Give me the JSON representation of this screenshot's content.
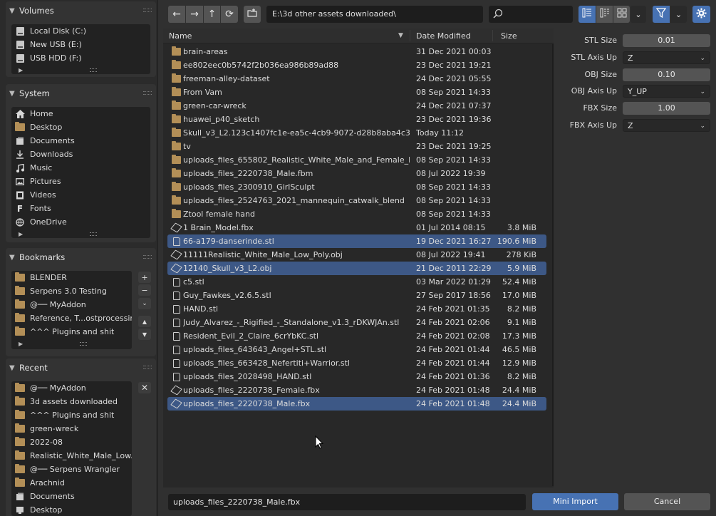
{
  "volumes": {
    "title": "Volumes",
    "items": [
      {
        "label": "Local Disk (C:)"
      },
      {
        "label": "New USB (E:)"
      },
      {
        "label": "USB HDD (F:)"
      }
    ]
  },
  "system": {
    "title": "System",
    "items": [
      {
        "label": "Home",
        "icon": "home-icon"
      },
      {
        "label": "Desktop",
        "icon": "desktop-icon"
      },
      {
        "label": "Documents",
        "icon": "documents-icon"
      },
      {
        "label": "Downloads",
        "icon": "download-icon"
      },
      {
        "label": "Music",
        "icon": "music-icon"
      },
      {
        "label": "Pictures",
        "icon": "pictures-icon"
      },
      {
        "label": "Videos",
        "icon": "videos-icon"
      },
      {
        "label": "Fonts",
        "icon": "font-icon"
      },
      {
        "label": "OneDrive",
        "icon": "onedrive-icon"
      }
    ]
  },
  "bookmarks": {
    "title": "Bookmarks",
    "items": [
      {
        "label": "BLENDER"
      },
      {
        "label": "Serpens 3.0 Testing"
      },
      {
        "label": "@── MyAddon"
      },
      {
        "label": "Reference, T...ostprocessing"
      },
      {
        "label": "^^^ Plugins and shit"
      }
    ]
  },
  "recent": {
    "title": "Recent",
    "items": [
      {
        "label": "@── MyAddon"
      },
      {
        "label": "3d assets downloaded"
      },
      {
        "label": "^^^ Plugins and shit"
      },
      {
        "label": "green-wreck"
      },
      {
        "label": "2022-08"
      },
      {
        "label": "Realistic_White_Male_Low..."
      },
      {
        "label": "@── Serpens Wrangler"
      },
      {
        "label": "Arachnid"
      },
      {
        "label": "Documents"
      },
      {
        "label": "Desktop"
      }
    ]
  },
  "toolbar": {
    "path": "E:\\3d other assets downloaded\\",
    "search_placeholder": ""
  },
  "columns": {
    "name": "Name",
    "date": "Date Modified",
    "size": "Size"
  },
  "files": [
    {
      "type": "folder",
      "name": "brain-areas",
      "date": "31 Dec 2021 00:03",
      "size": "",
      "selected": false
    },
    {
      "type": "folder",
      "name": "ee802eec0b5742f2b036ea986b89ad88",
      "date": "23 Dec 2021 19:21",
      "size": "",
      "selected": false
    },
    {
      "type": "folder",
      "name": "freeman-alley-dataset",
      "date": "24 Dec 2021 05:55",
      "size": "",
      "selected": false
    },
    {
      "type": "folder",
      "name": "From Vam",
      "date": "08 Sep 2021 14:33",
      "size": "",
      "selected": false
    },
    {
      "type": "folder",
      "name": "green-car-wreck",
      "date": "24 Dec 2021 07:37",
      "size": "",
      "selected": false
    },
    {
      "type": "folder",
      "name": "huawei_p40_sketch",
      "date": "23 Dec 2021 19:36",
      "size": "",
      "selected": false
    },
    {
      "type": "folder",
      "name": "Skull_v3_L2.123c1407fc1e-ea5c-4cb9-9072-d28b8aba4c36",
      "date": "Today 11:12",
      "size": "",
      "selected": false
    },
    {
      "type": "folder",
      "name": "tv",
      "date": "23 Dec 2021 19:25",
      "size": "",
      "selected": false
    },
    {
      "type": "folder",
      "name": "uploads_files_655802_Realistic_White_Male_and_Female_Low_Po",
      "date": "08 Sep 2021 14:33",
      "size": "",
      "selected": false
    },
    {
      "type": "folder",
      "name": "uploads_files_2220738_Male.fbm",
      "date": "08 Jul 2022 19:39",
      "size": "",
      "selected": false
    },
    {
      "type": "folder",
      "name": "uploads_files_2300910_GirlSculpt",
      "date": "08 Sep 2021 14:33",
      "size": "",
      "selected": false
    },
    {
      "type": "folder",
      "name": "uploads_files_2524763_2021_mannequin_catwalk_blend",
      "date": "08 Sep 2021 14:33",
      "size": "",
      "selected": false
    },
    {
      "type": "folder",
      "name": "Ztool female hand",
      "date": "08 Sep 2021 14:33",
      "size": "",
      "selected": false
    },
    {
      "type": "mesh",
      "name": "1 Brain_Model.fbx",
      "date": "01 Jul 2014 08:15",
      "size": "3.8 MiB",
      "selected": false
    },
    {
      "type": "file",
      "name": "66-a179-danserinde.stl",
      "date": "19 Dec 2021 16:27",
      "size": "190.6 MiB",
      "selected": true
    },
    {
      "type": "mesh",
      "name": "11111Realistic_White_Male_Low_Poly.obj",
      "date": "08 Jul 2022 19:41",
      "size": "278 KiB",
      "selected": false
    },
    {
      "type": "mesh",
      "name": "12140_Skull_v3_L2.obj",
      "date": "21 Dec 2011 22:29",
      "size": "5.9 MiB",
      "selected": true
    },
    {
      "type": "file",
      "name": "c5.stl",
      "date": "03 Mar 2022 01:29",
      "size": "52.4 MiB",
      "selected": false
    },
    {
      "type": "file",
      "name": "Guy_Fawkes_v2.6.5.stl",
      "date": "27 Sep 2017 18:56",
      "size": "17.0 MiB",
      "selected": false
    },
    {
      "type": "file",
      "name": "HAND.stl",
      "date": "24 Feb 2021 01:35",
      "size": "8.2 MiB",
      "selected": false
    },
    {
      "type": "file",
      "name": "Judy_Alvarez_-_Rigified_-_Standalone_v1.3_rDKWJAn.stl",
      "date": "24 Feb 2021 02:06",
      "size": "9.1 MiB",
      "selected": false
    },
    {
      "type": "file",
      "name": "Resident_Evil_2_Claire_6crYbKC.stl",
      "date": "24 Feb 2021 02:08",
      "size": "17.3 MiB",
      "selected": false
    },
    {
      "type": "file",
      "name": "uploads_files_643643_Angel+STL.stl",
      "date": "24 Feb 2021 01:44",
      "size": "46.5 MiB",
      "selected": false
    },
    {
      "type": "file",
      "name": "uploads_files_663428_Nefertiti+Warrior.stl",
      "date": "24 Feb 2021 01:44",
      "size": "12.9 MiB",
      "selected": false
    },
    {
      "type": "file",
      "name": "uploads_files_2028498_HAND.stl",
      "date": "24 Feb 2021 01:36",
      "size": "8.2 MiB",
      "selected": false
    },
    {
      "type": "mesh",
      "name": "uploads_files_2220738_Female.fbx",
      "date": "24 Feb 2021 01:48",
      "size": "24.4 MiB",
      "selected": false
    },
    {
      "type": "mesh",
      "name": "uploads_files_2220738_Male.fbx",
      "date": "24 Feb 2021 01:48",
      "size": "24.4 MiB",
      "selected": true
    }
  ],
  "properties": [
    {
      "label": "STL Size",
      "kind": "number",
      "value": "0.01"
    },
    {
      "label": "STL Axis Up",
      "kind": "select",
      "value": "Z"
    },
    {
      "label": "OBJ Size",
      "kind": "number",
      "value": "0.10"
    },
    {
      "label": "OBJ Axis Up",
      "kind": "select",
      "value": "Y_UP"
    },
    {
      "label": "FBX Size",
      "kind": "number",
      "value": "1.00"
    },
    {
      "label": "FBX Axis Up",
      "kind": "select",
      "value": "Z"
    }
  ],
  "bottom": {
    "filename": "uploads_files_2220738_Male.fbx",
    "import_label": "Mini Import",
    "cancel_label": "Cancel"
  },
  "colors": {
    "accent": "#4772b3",
    "selection": "#3d5886",
    "folder": "#b38f57"
  }
}
